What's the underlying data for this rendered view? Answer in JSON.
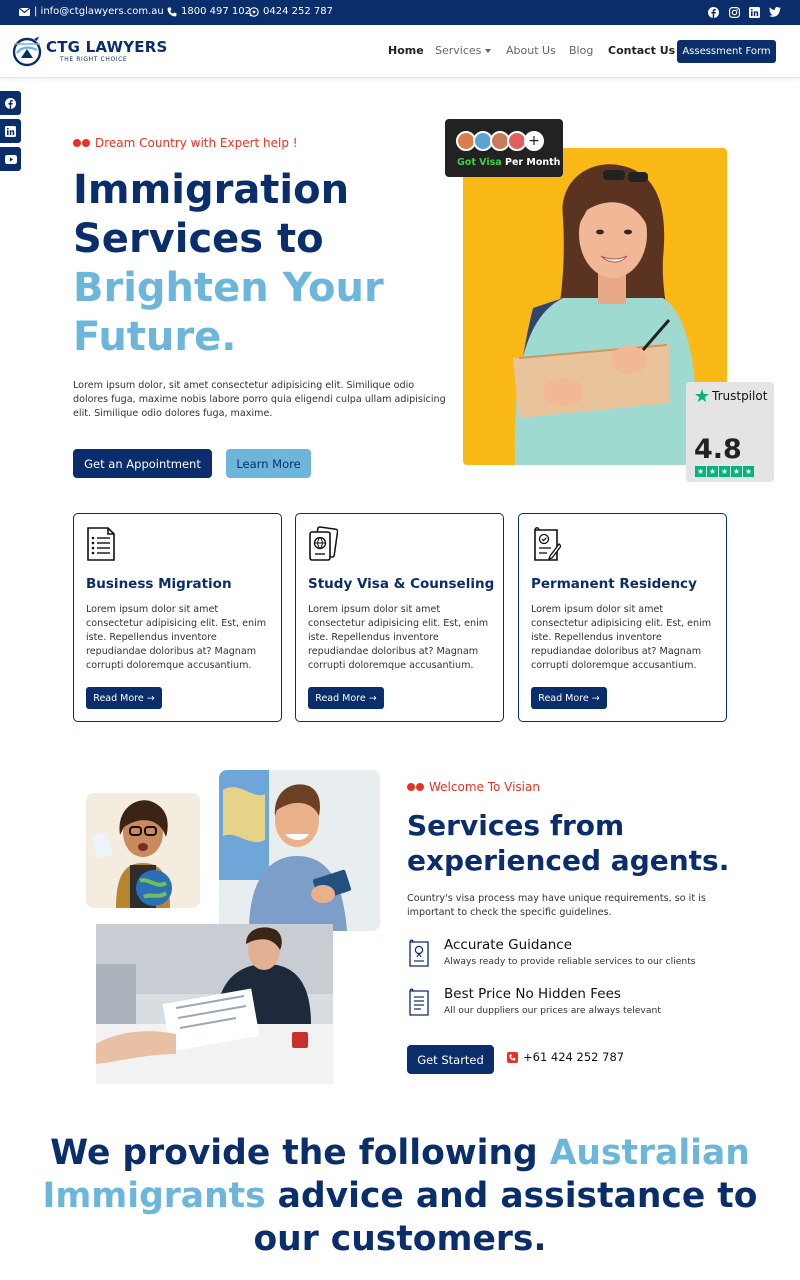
{
  "colors": {
    "navy": "#0a2d6b",
    "light_blue": "#6cb6dc",
    "accent_red": "#e63222",
    "yellow": "#fbb917",
    "trustpilot_green": "#00b67a"
  },
  "topbar": {
    "email": "| info@ctglawyers.com.au",
    "phone": "1800 497 102",
    "whatsapp": "0424 252 787",
    "social_icons": [
      "facebook-icon",
      "instagram-icon",
      "linkedin-icon",
      "twitter-icon"
    ]
  },
  "nav": {
    "logo_name": "CTG LAWYERS",
    "logo_tagline": "THE RIGHT CHOICE",
    "links": [
      {
        "label": "Home",
        "active": true
      },
      {
        "label": "Services"
      },
      {
        "label": "About Us"
      },
      {
        "label": "Blog"
      },
      {
        "label": "Contact Us"
      }
    ],
    "cta": "Assessment Form"
  },
  "side_social": [
    "facebook-icon",
    "linkedin-icon",
    "youtube-icon"
  ],
  "hero": {
    "eyebrow": "Dream Country with Expert help !",
    "title_line1": "Immigration",
    "title_line2": "Services to",
    "title_line3": "Brighten Your",
    "title_line4": "Future.",
    "description": "Lorem ipsum dolor, sit amet consectetur adipisicing elit. Similique odio dolores fuga, maxime nobis labore porro quia eligendi culpa ullam adipisicing elit. Similique odio dolores fuga, maxime.",
    "primary_button": "Get an Appointment",
    "secondary_button": "Learn More",
    "visa_badge": {
      "plus": "+",
      "highlight": "Got Visa",
      "rest": " Per Month"
    },
    "trustpilot": {
      "brand": "Trustpilot",
      "score": "4.8",
      "stars": 5
    }
  },
  "services": [
    {
      "icon": "document-icon",
      "title": "Business Migration",
      "text": "Lorem ipsum dolor sit amet consectetur adipisicing elit. Est, enim iste. Repellendus inventore repudiandae doloribus at? Magnam corrupti doloremque accusantium.",
      "button": "Read More →"
    },
    {
      "icon": "passport-icon",
      "title": "Study Visa & Counseling",
      "text": "Lorem ipsum dolor sit amet consectetur adipisicing elit. Est, enim iste. Repellendus inventore repudiandae doloribus at? Magnam corrupti doloremque accusantium.",
      "button": "Read More →"
    },
    {
      "icon": "certificate-icon",
      "title": "Permanent Residency",
      "text": "Lorem ipsum dolor sit amet consectetur adipisicing elit. Est, enim iste. Repellendus inventore repudiandae doloribus at? Magnam corrupti doloremque accusantium.",
      "button": "Read More →"
    }
  ],
  "about": {
    "eyebrow": "Welcome To Visian",
    "title_line1": "Services from",
    "title_line2": "experienced agents.",
    "description": "Country's visa process may have unique requirements, so it is important to check the specific guidelines.",
    "features": [
      {
        "icon": "guidance-icon",
        "title": "Accurate Guidance",
        "subtitle": "Always ready to provide reliable services to our clients"
      },
      {
        "icon": "price-list-icon",
        "title": "Best Price No Hidden Fees",
        "subtitle": "All our duppliers our prices are always televant"
      }
    ],
    "cta": "Get Started",
    "phone": "+61 424 252 787"
  },
  "bottom": {
    "part1": "We provide the following ",
    "highlight": "Australian Immigrants",
    "part2": " advice and assistance to our customers."
  }
}
